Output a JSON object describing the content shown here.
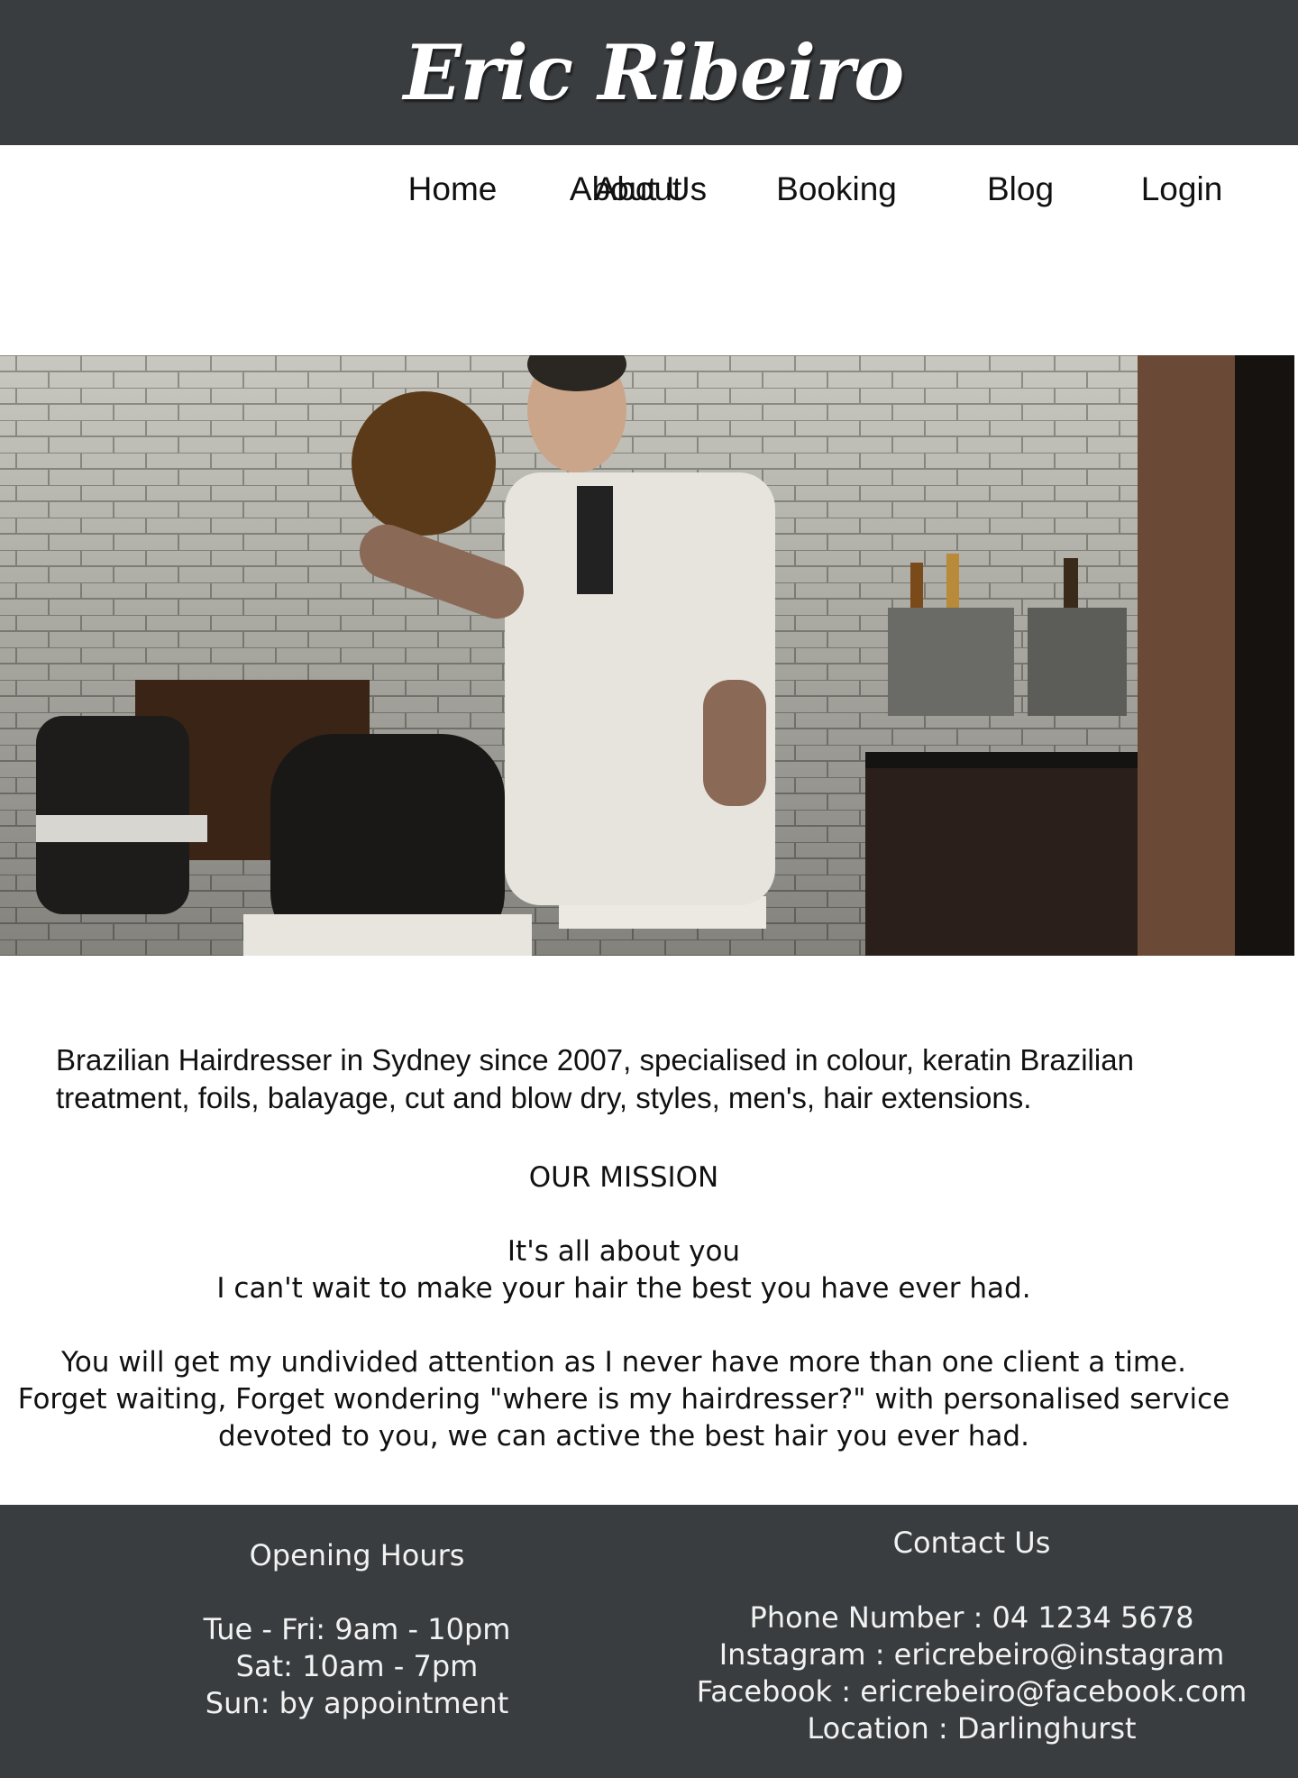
{
  "header": {
    "title": "Eric Ribeiro"
  },
  "nav": {
    "items": [
      {
        "label": "Home"
      },
      {
        "label": "About"
      },
      {
        "label": "Booking"
      },
      {
        "label": "Blog"
      },
      {
        "label": "Login"
      }
    ],
    "sub_item": "About Us"
  },
  "intro": {
    "text": "Brazilian Hairdresser in Sydney since 2007, specialised in colour, keratin Brazilian treatment, foils, balayage, cut and blow dry, styles, men's, hair extensions."
  },
  "mission": {
    "heading": "OUR MISSION",
    "line1": "It's all about you",
    "line2": "I can't wait to make your hair the best you have ever had.",
    "para1": "You will get my undivided attention as I never have more than one client a time.",
    "para2": "Forget waiting, Forget wondering \"where is my hairdresser?\" with personalised service",
    "para3": "devoted to you, we can active the best hair you ever had."
  },
  "footer": {
    "hours": {
      "heading": "Opening Hours",
      "lines": [
        "Tue - Fri: 9am - 10pm",
        "Sat: 10am - 7pm",
        "Sun: by appointment"
      ]
    },
    "contact": {
      "heading": "Contact Us",
      "lines": [
        "Phone Number : 04 1234 5678",
        "Instagram : ericrebeiro@instagram",
        "Facebook : ericrebeiro@facebook.com",
        "Location : Darlinghurst"
      ]
    }
  },
  "colors": {
    "header_bg": "#3a3d40",
    "footer_bg": "#3a3d40",
    "text": "#111111"
  }
}
